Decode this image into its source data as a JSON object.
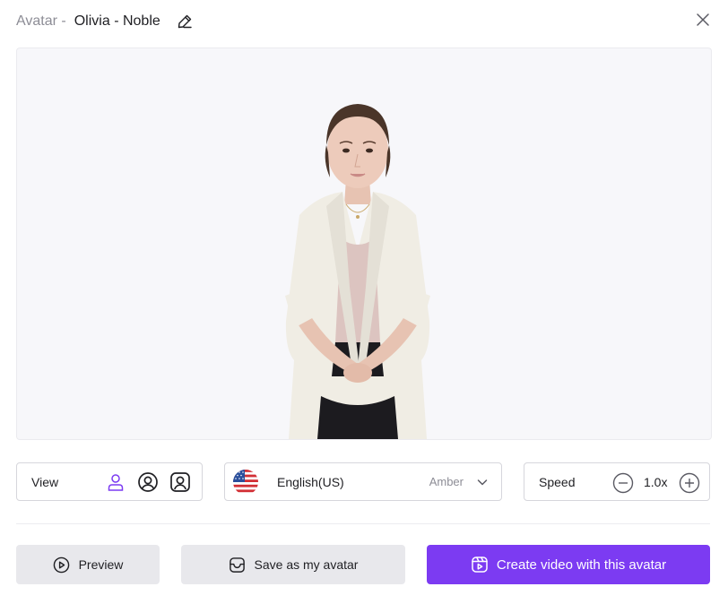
{
  "header": {
    "title_prefix": "Avatar -",
    "avatar_name": "Olivia - Noble"
  },
  "controls": {
    "view": {
      "label": "View",
      "options": [
        "full-body-icon",
        "head-circle-icon",
        "portrait-square-icon"
      ],
      "selected": "full-body-icon"
    },
    "language": {
      "label": "English(US)",
      "flag_icon": "us-flag-icon",
      "voice": "Amber"
    },
    "speed": {
      "label": "Speed",
      "value": "1.0x"
    }
  },
  "actions": {
    "preview_label": "Preview",
    "save_label": "Save as my avatar",
    "create_label": "Create video with this avatar"
  },
  "colors": {
    "accent": "#7c3bf2",
    "secondary_button": "#e8e8ec",
    "stage_background": "#f7f7fa",
    "muted_text": "#8d8d96"
  }
}
